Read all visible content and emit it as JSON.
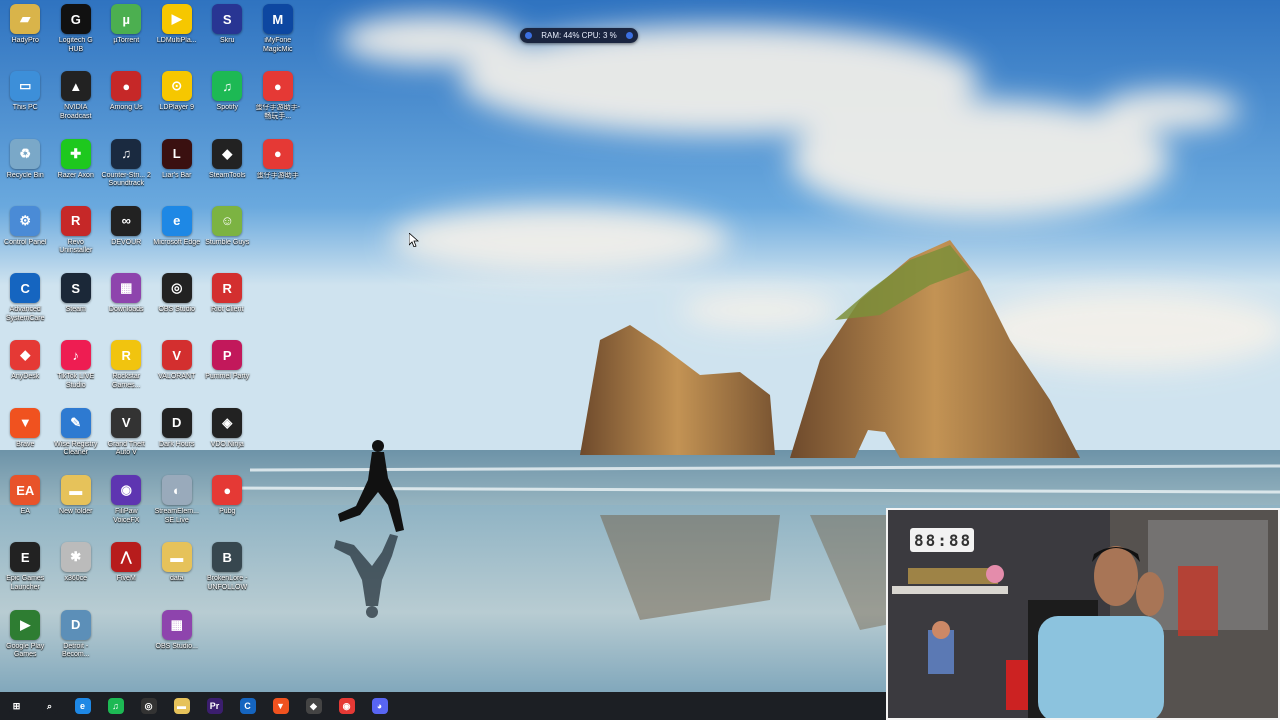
{
  "desktop_icons": [
    {
      "label": "HadyPro",
      "glyph": "▰",
      "color": "#d9b44a"
    },
    {
      "label": "This PC",
      "glyph": "▭",
      "color": "#3d8fd9"
    },
    {
      "label": "Recycle Bin",
      "glyph": "♻",
      "color": "#7aa8c8"
    },
    {
      "label": "Control Panel",
      "glyph": "⚙",
      "color": "#4a8bd6"
    },
    {
      "label": "Advanced SystemCare",
      "glyph": "C",
      "color": "#1565c0"
    },
    {
      "label": "AnyDesk",
      "glyph": "◆",
      "color": "#e53935"
    },
    {
      "label": "Brave",
      "glyph": "▼",
      "color": "#f0521f"
    },
    {
      "label": "EA",
      "glyph": "EA",
      "color": "#e8532a"
    },
    {
      "label": "Epic Games Launcher",
      "glyph": "E",
      "color": "#222"
    },
    {
      "label": "Google Play Games",
      "glyph": "▶",
      "color": "#2e7d32"
    },
    {
      "label": "Logitech G HUB",
      "glyph": "G",
      "color": "#111"
    },
    {
      "label": "NVIDIA Broadcast",
      "glyph": "▲",
      "color": "#222"
    },
    {
      "label": "Razer Axon",
      "glyph": "✚",
      "color": "#1ec81e"
    },
    {
      "label": "Revo Uninstaller",
      "glyph": "R",
      "color": "#c62828"
    },
    {
      "label": "Steam",
      "glyph": "S",
      "color": "#1b2838"
    },
    {
      "label": "TikTok LIVE Studio",
      "glyph": "♪",
      "color": "#ee1d52"
    },
    {
      "label": "Wise Registry Cleaner",
      "glyph": "✎",
      "color": "#2e7ad1"
    },
    {
      "label": "New folder",
      "glyph": "▬",
      "color": "#e6c25a"
    },
    {
      "label": "x360ce",
      "glyph": "✱",
      "color": "#bbb"
    },
    {
      "label": "Detroit - Becom...",
      "glyph": "D",
      "color": "#5c8fb8"
    },
    {
      "label": "µTorrent",
      "glyph": "µ",
      "color": "#4caf50"
    },
    {
      "label": "Among Us",
      "glyph": "●",
      "color": "#c62828"
    },
    {
      "label": "Counter-Stri... 2 Soundtrack",
      "glyph": "♫",
      "color": "#1a2a40"
    },
    {
      "label": "DEVOUR",
      "glyph": "∞",
      "color": "#222"
    },
    {
      "label": "Downloads",
      "glyph": "▦",
      "color": "#8e44ad"
    },
    {
      "label": "Rockstar Games...",
      "glyph": "R",
      "color": "#f1c40f"
    },
    {
      "label": "Grand Theft Auto V",
      "glyph": "V",
      "color": "#333"
    },
    {
      "label": "FiliPaw VoiceFX",
      "glyph": "◉",
      "color": "#5e35b1"
    },
    {
      "label": "FiveM",
      "glyph": "⋀",
      "color": "#b71c1c"
    },
    {
      "label": "LDMultiPla...",
      "glyph": "▶",
      "color": "#f6c700"
    },
    {
      "label": "LDPlayer 9",
      "glyph": "⊙",
      "color": "#f6c700"
    },
    {
      "label": "Liar's Bar",
      "glyph": "L",
      "color": "#3a1010"
    },
    {
      "label": "Microsoft Edge",
      "glyph": "e",
      "color": "#1e88e5"
    },
    {
      "label": "OBS Studio",
      "glyph": "◎",
      "color": "#222"
    },
    {
      "label": "VALORANT",
      "glyph": "V",
      "color": "#d32f2f"
    },
    {
      "label": "Dark Hours",
      "glyph": "D",
      "color": "#222"
    },
    {
      "label": "StreamElem... SE.Live",
      "glyph": "◐",
      "color": "#9ab"
    },
    {
      "label": "data",
      "glyph": "▬",
      "color": "#e6c25a"
    },
    {
      "label": "OBS Studio...",
      "glyph": "▦",
      "color": "#8e44ad"
    },
    {
      "label": "Skru",
      "glyph": "S",
      "color": "#283593"
    },
    {
      "label": "Spotify",
      "glyph": "♫",
      "color": "#1db954"
    },
    {
      "label": "SteamTools",
      "glyph": "◆",
      "color": "#222"
    },
    {
      "label": "Stumble Guys",
      "glyph": "☺",
      "color": "#7cb342"
    },
    {
      "label": "Riot Client",
      "glyph": "R",
      "color": "#d32f2f"
    },
    {
      "label": "Pummel Party",
      "glyph": "P",
      "color": "#c2185b"
    },
    {
      "label": "VDO.Ninja",
      "glyph": "◈",
      "color": "#222"
    },
    {
      "label": "Pubg",
      "glyph": "●",
      "color": "#e53935"
    },
    {
      "label": "BrokenLore - UNFOLLOW",
      "glyph": "B",
      "color": "#37474f"
    },
    {
      "label": "iMyFone MagicMic",
      "glyph": "M",
      "color": "#0d47a1"
    },
    {
      "label": "蛋仔手游助手-畅玩手...",
      "glyph": "●",
      "color": "#e53935"
    },
    {
      "label": "蛋仔手游助手",
      "glyph": "●",
      "color": "#e53935"
    }
  ],
  "perf_monitor": {
    "text": "RAM: 44%  CPU: 3 %"
  },
  "webcam": {
    "clock": "88:88"
  },
  "taskbar": {
    "items": [
      {
        "name": "start",
        "glyph": "⊞",
        "color": "#1c1f24"
      },
      {
        "name": "search",
        "glyph": "⌕",
        "color": "#1c1f24"
      },
      {
        "name": "edge",
        "glyph": "e",
        "color": "#1e88e5"
      },
      {
        "name": "spotify",
        "glyph": "♫",
        "color": "#1db954"
      },
      {
        "name": "obs",
        "glyph": "◎",
        "color": "#333"
      },
      {
        "name": "explorer",
        "glyph": "▬",
        "color": "#e6c25a"
      },
      {
        "name": "premiere",
        "glyph": "Pr",
        "color": "#3b1e6e"
      },
      {
        "name": "advanced-systemcare",
        "glyph": "C",
        "color": "#1565c0"
      },
      {
        "name": "brave",
        "glyph": "▼",
        "color": "#f0521f"
      },
      {
        "name": "steamtools",
        "glyph": "◆",
        "color": "#444"
      },
      {
        "name": "chrome",
        "glyph": "◉",
        "color": "#e53935"
      },
      {
        "name": "discord",
        "glyph": "◕",
        "color": "#5865f2"
      }
    ]
  }
}
